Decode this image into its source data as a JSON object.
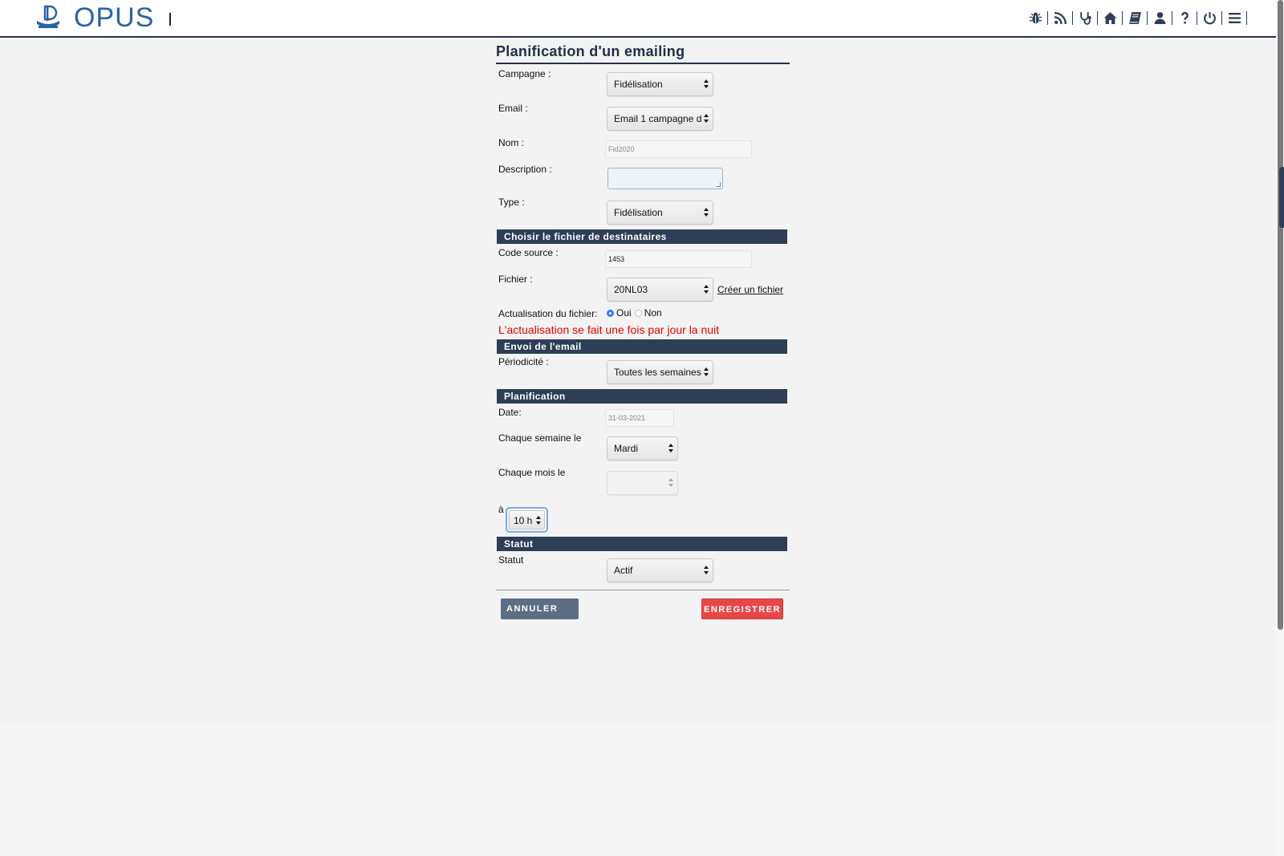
{
  "app": {
    "name": "OPUS"
  },
  "header": {
    "icons": [
      "bug-icon",
      "rss-icon",
      "stethoscope-icon",
      "home-icon",
      "book-icon",
      "user-icon",
      "help-icon",
      "power-icon",
      "menu-icon"
    ]
  },
  "form": {
    "title": "Planification d'un emailing",
    "campagne": {
      "label": "Campagne :",
      "value": "Fidélisation"
    },
    "email": {
      "label": "Email :",
      "value": "Email 1 campagne d"
    },
    "nom": {
      "label": "Nom :",
      "value": "Fid2020"
    },
    "description": {
      "label": "Description :",
      "value": ""
    },
    "type": {
      "label": "Type :",
      "value": "Fidélisation"
    },
    "section_fichier": "Choisir le fichier de destinataires",
    "code_source": {
      "label": "Code source :",
      "value": "1453"
    },
    "fichier": {
      "label": "Fichier :",
      "value": "20NL03",
      "link": "Créer un fichier"
    },
    "actualisation": {
      "label": "Actualisation du fichier:",
      "oui": "Oui",
      "non": "Non",
      "selected": "Oui"
    },
    "warning": "L'actualisation se fait une fois par jour la nuit",
    "section_envoi": "Envoi de l'email",
    "periodicite": {
      "label": "Périodicité :",
      "value": "Toutes les semaines"
    },
    "section_planif": "Planification",
    "date": {
      "label": "Date:",
      "value": "31-03-2021"
    },
    "chaque_semaine": {
      "label": "Chaque semaine le",
      "value": "Mardi"
    },
    "chaque_mois": {
      "label": "Chaque mois le",
      "value": ""
    },
    "heure": {
      "label": "à",
      "value": "10 h"
    },
    "section_statut": "Statut",
    "statut": {
      "label": "Statut",
      "value": "Actif"
    },
    "buttons": {
      "cancel": "ANNULER",
      "save": "ENREGISTRER"
    }
  },
  "colors": {
    "brand": "#2a62a7",
    "navy": "#2e3e56",
    "warning": "#e00000",
    "save": "#e8474a",
    "cancel": "#5c6e83"
  }
}
